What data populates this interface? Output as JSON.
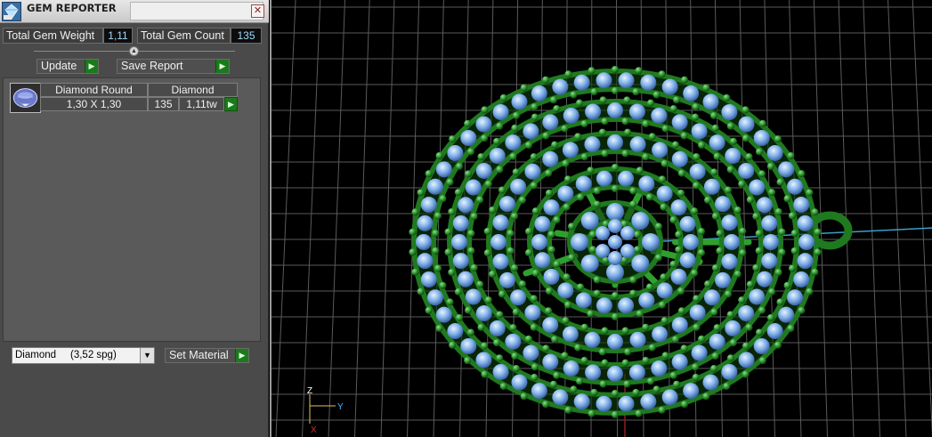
{
  "window": {
    "title": "GEM REPORTER",
    "close_glyph": "✕"
  },
  "totals": {
    "weight_label": "Total Gem Weight",
    "weight_value": "1,11",
    "count_label": "Total Gem Count",
    "count_value": "135"
  },
  "actions": {
    "update_label": "Update",
    "save_label": "Save Report"
  },
  "gem_table": {
    "columns": [
      "Diamond Round",
      "Diamond"
    ],
    "rows": [
      {
        "size": "1,30 X 1,30",
        "count": "135",
        "weight": "1,11tw"
      }
    ]
  },
  "material": {
    "selected": "Diamond     (3,52 spg)",
    "set_label": "Set Material"
  },
  "axes": {
    "z": "Z",
    "y": "Y",
    "x": "X"
  },
  "colors": {
    "metal": "#1f7a1f",
    "prong": "#2ea02e",
    "gem": "#7fb0e8",
    "grid": "#5a5a5a",
    "axis_y": "#3aa0c8",
    "axis_x": "#b03030"
  },
  "icons": {
    "title": "gem-reporter-icon",
    "close": "close-icon",
    "collapse": "collapse-icon",
    "go": "play-arrow-icon",
    "dropdown": "chevron-down-icon",
    "gem_thumb": "round-diamond-icon"
  }
}
